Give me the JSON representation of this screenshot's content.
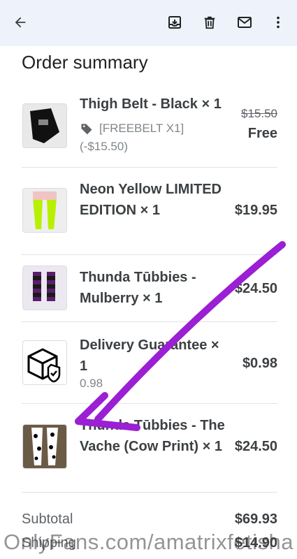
{
  "header": {
    "back_icon": "arrow-left-icon",
    "archive_icon": "archive-icon",
    "delete_icon": "trash-icon",
    "mail_icon": "mail-icon",
    "more_icon": "more-vert-icon",
    "background": "#eef3fb"
  },
  "title": "Order summary",
  "items": [
    {
      "name": "Thigh Belt - Black × 1",
      "price_original": "$15.50",
      "price": "Free",
      "coupon": "[FREEBELT X1]",
      "discount": "(-$15.50)"
    },
    {
      "name": "Neon Yellow LIMITED EDITION × 1",
      "price": "$19.95"
    },
    {
      "name": "Thunda Tūbbies - Mulberry × 1",
      "price": "$24.50"
    },
    {
      "name": "Delivery Guarantee × 1",
      "price": "$0.98",
      "sub": "0.98"
    },
    {
      "name": "Thunda Tūbbies - The Vache (Cow Print) × 1",
      "price": "$24.50"
    }
  ],
  "totals": {
    "subtotal_label": "Subtotal",
    "subtotal_value": "$69.93",
    "shipping_label": "Shipping",
    "shipping_value": "$14.90"
  },
  "watermark": "OnlyFans.com/amatrixfetisha",
  "annotation_color": "#9b1fd3"
}
